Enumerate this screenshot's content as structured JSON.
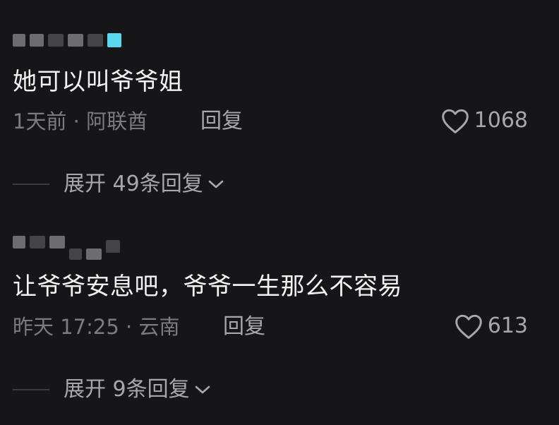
{
  "comments": [
    {
      "text": "她可以叫爷爷姐",
      "time_location": "1天前 · 阿联酋",
      "reply_label": "回复",
      "like_count": "1068",
      "expand_label": "展开 49条回复"
    },
    {
      "text": "让爷爷安息吧，爷爷一生那么不容易",
      "time_location": "昨天 17:25 · 云南",
      "reply_label": "回复",
      "like_count": "613",
      "expand_label": "展开 9条回复"
    }
  ],
  "icons": {
    "like": "heart-outline-icon",
    "expand": "chevron-down-icon"
  },
  "colors": {
    "background": "#161618",
    "primary_text": "#f2f2f2",
    "secondary_text": "#7c7c80",
    "action_text": "#a8a8ac",
    "badge_accent": "#5ad6ee"
  }
}
